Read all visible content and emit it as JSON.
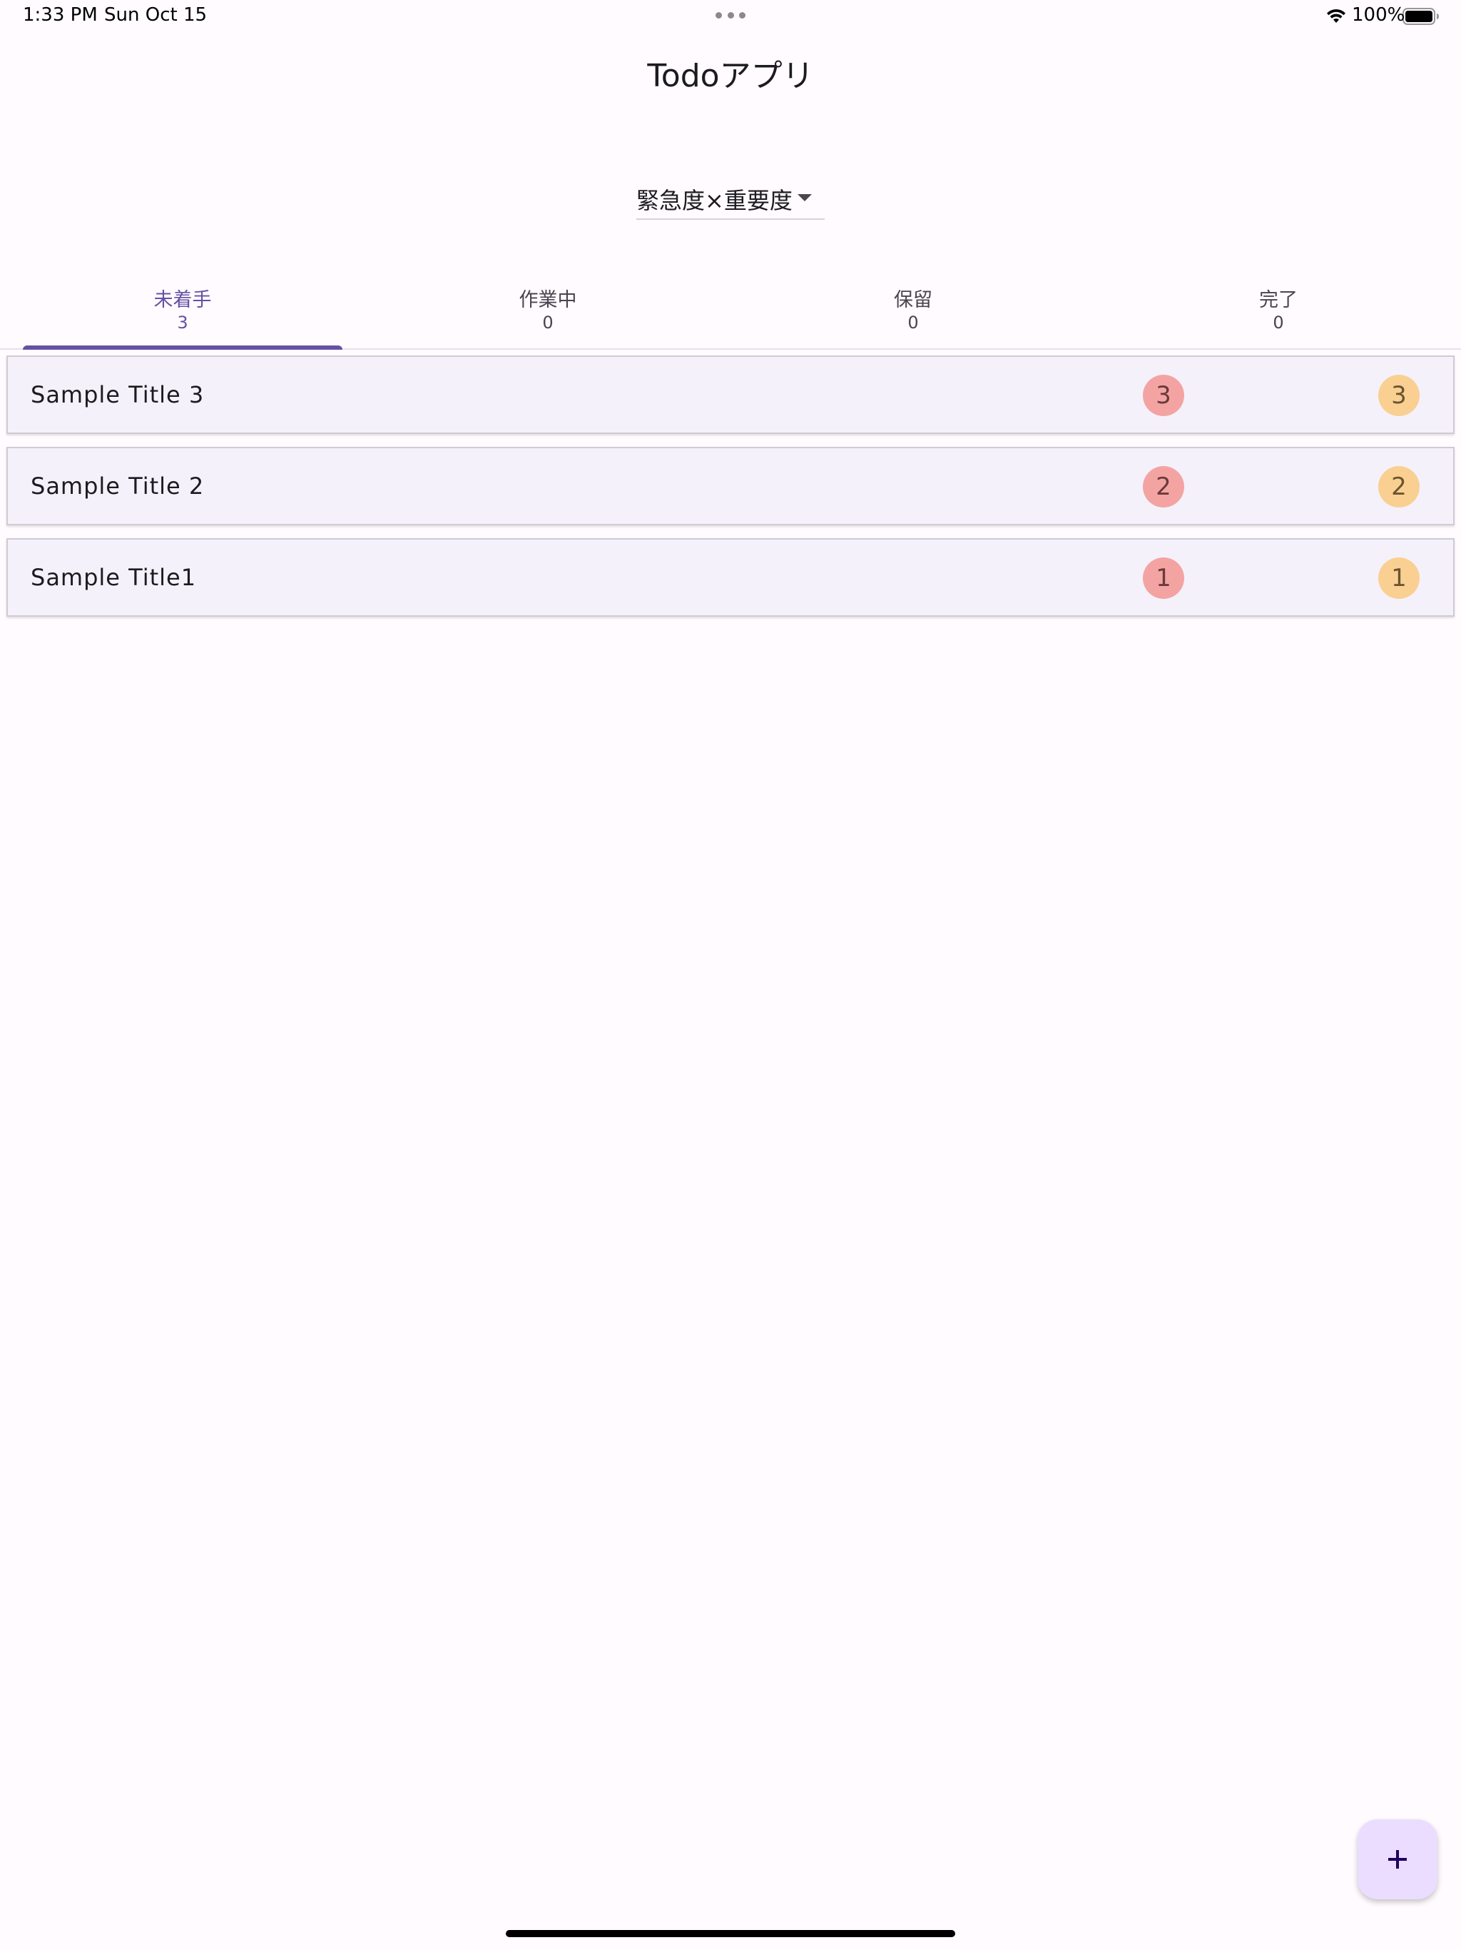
{
  "status_bar": {
    "time": "1:33 PM",
    "date": "Sun Oct 15",
    "battery_pct": "100%"
  },
  "app": {
    "title": "Todoアプリ"
  },
  "sort": {
    "selected": "緊急度×重要度"
  },
  "tabs": [
    {
      "label": "未着手",
      "count": "3",
      "active": true
    },
    {
      "label": "作業中",
      "count": "0",
      "active": false
    },
    {
      "label": "保留",
      "count": "0",
      "active": false
    },
    {
      "label": "完了",
      "count": "0",
      "active": false
    }
  ],
  "tasks": [
    {
      "title": "Sample Title 3",
      "urgency": "3",
      "importance": "3"
    },
    {
      "title": "Sample Title 2",
      "urgency": "2",
      "importance": "2"
    },
    {
      "title": "Sample Title1",
      "urgency": "1",
      "importance": "1"
    }
  ],
  "colors": {
    "accent": "#6750a4",
    "urgency_badge": "#f4a3a3",
    "importance_badge": "#f9d092",
    "fab_background": "#eaddff",
    "card_background": "#f5f1fa"
  },
  "icons": {
    "fab": "plus-icon",
    "dropdown": "arrow-drop-down-icon",
    "wifi": "wifi-icon",
    "battery": "battery-icon",
    "multitask": "multitasking-dots-icon"
  }
}
